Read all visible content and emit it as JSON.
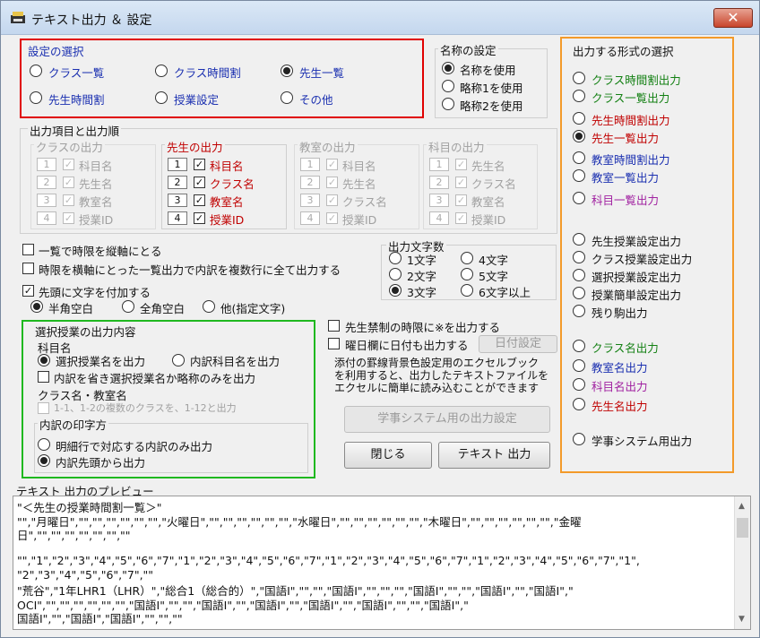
{
  "window": {
    "title": "テキスト出力 ＆ 設定",
    "close": "✕"
  },
  "setting_select": {
    "legend": "設定の選択",
    "options": [
      "クラス一覧",
      "クラス時間割",
      "先生一覧",
      "先生時間割",
      "授業設定",
      "その他"
    ],
    "selected": "先生一覧"
  },
  "name_setting": {
    "legend": "名称の設定",
    "options": [
      "名称を使用",
      "略称1を使用",
      "略称2を使用"
    ],
    "selected": "名称を使用"
  },
  "output_items": {
    "legend": "出力項目と出力順",
    "groups": [
      {
        "title": "クラスの出力",
        "items": [
          "科目名",
          "先生名",
          "教室名",
          "授業ID"
        ],
        "nums": [
          "1",
          "2",
          "3",
          "4"
        ],
        "enabled": false
      },
      {
        "title": "先生の出力",
        "items": [
          "科目名",
          "クラス名",
          "教室名",
          "授業ID"
        ],
        "nums": [
          "1",
          "2",
          "3",
          "4"
        ],
        "enabled": true
      },
      {
        "title": "教室の出力",
        "items": [
          "科目名",
          "先生名",
          "クラス名",
          "授業ID"
        ],
        "nums": [
          "1",
          "2",
          "3",
          "4"
        ],
        "enabled": false
      },
      {
        "title": "科目の出力",
        "items": [
          "先生名",
          "クラス名",
          "教室名",
          "授業ID"
        ],
        "nums": [
          "1",
          "2",
          "3",
          "4"
        ],
        "enabled": false
      }
    ]
  },
  "options": {
    "vertical_period": "一覧で時限を縦軸にとる",
    "multiline": "時限を横軸にとった一覧出力で内訳を複数行に全て出力する",
    "prefix": "先頭に文字を付加する",
    "prefix_options": [
      "半角空白",
      "全角空白",
      "他(指定文字)"
    ],
    "prefix_selected": "半角空白"
  },
  "char_count": {
    "legend": "出力文字数",
    "options": [
      "1文字",
      "4文字",
      "2文字",
      "5文字",
      "3文字",
      "6文字以上"
    ],
    "selected": "3文字"
  },
  "selected_lesson": {
    "legend": "選択授業の出力内容",
    "subject_label": "科目名",
    "subject_options": [
      "選択授業名を出力",
      "内訳科目名を出力"
    ],
    "subject_selected": "選択授業名を出力",
    "omit_label": "内訳を省き選択授業名か略称のみを出力",
    "class_room_label": "クラス名・教室名",
    "class_room_note": "1-1、1-2の複数のクラスを、1-12と出力",
    "print_label": "内訳の印字方",
    "print_options": [
      "明細行で対応する内訳のみ出力",
      "内訳先頭から出力"
    ],
    "print_selected": "内訳先頭から出力"
  },
  "middle": {
    "forbidden": "先生禁制の時限に※を出力する",
    "date_in_weekday": "曜日欄に日付も出力する",
    "date_setting_button": "日付設定",
    "note_lines": [
      "添付の罫線背景色設定用のエクセルブック",
      "を利用すると、出力したテキストファイルを",
      "エクセルに簡単に読み込むことができます"
    ],
    "gakuji_button": "学事システム用の出力設定",
    "close_button": "閉じる",
    "text_output_button": "テキスト 出力"
  },
  "format_select": {
    "legend": "出力する形式の選択",
    "items": [
      {
        "label": "クラス時間割出力",
        "color": "#138013"
      },
      {
        "label": "クラス一覧出力",
        "color": "#138013"
      },
      {
        "label": "先生時間割出力",
        "color": "#c00000"
      },
      {
        "label": "先生一覧出力",
        "color": "#c00000"
      },
      {
        "label": "教室時間割出力",
        "color": "#1a2fb0"
      },
      {
        "label": "教室一覧出力",
        "color": "#1a2fb0"
      },
      {
        "label": "科目一覧出力",
        "color": "#a020a0"
      },
      {
        "label": "先生授業設定出力",
        "color": "#111111"
      },
      {
        "label": "クラス授業設定出力",
        "color": "#111111"
      },
      {
        "label": "選択授業設定出力",
        "color": "#111111"
      },
      {
        "label": "授業簡単設定出力",
        "color": "#111111"
      },
      {
        "label": "残り駒出力",
        "color": "#111111"
      },
      {
        "label": "クラス名出力",
        "color": "#138013"
      },
      {
        "label": "教室名出力",
        "color": "#1a2fb0"
      },
      {
        "label": "科目名出力",
        "color": "#a020a0"
      },
      {
        "label": "先生名出力",
        "color": "#c00000"
      },
      {
        "label": "学事システム用出力",
        "color": "#111111"
      }
    ],
    "selected": "先生一覧出力"
  },
  "preview": {
    "label": "テキスト 出力のプレビュー",
    "lines": [
      "\"＜先生の授業時間割一覧＞\"",
      "\"\",\"月曜日\",\"\",\"\",\"\",\"\",\"\",\"\",\"火曜日\",\"\",\"\",\"\",\"\",\"\",\"\",\"水曜日\",\"\",\"\",\"\",\"\",\"\",\"\",\"木曜日\",\"\",\"\",\"\",\"\",\"\",\"\",\"金曜",
      "日\",\"\",\"\",\"\",\"\",\"\",\"\",\"\"",
      "",
      "\"\",\"1\",\"2\",\"3\",\"4\",\"5\",\"6\",\"7\",\"1\",\"2\",\"3\",\"4\",\"5\",\"6\",\"7\",\"1\",\"2\",\"3\",\"4\",\"5\",\"6\",\"7\",\"1\",\"2\",\"3\",\"4\",\"5\",\"6\",\"7\",\"1\",",
      "\"2\",\"3\",\"4\",\"5\",\"6\",\"7\",\"\"",
      "\"荒谷\",\"1年LHR1（LHR）\",\"総合1（総合的）\",\"国語Ⅰ\",\"\",\"\",\"国語Ⅰ\",\"\",\"\",\"\",\"国語Ⅰ\",\"\",\"\",\"国語Ⅰ\",\"\",\"国語Ⅰ\",\"",
      "OCⅠ\",\"\",\"\",\"\",\"\",\"\",\"\",\"国語Ⅰ\",\"\",\"\",\"国語Ⅰ\",\"\",\"国語Ⅰ\",\"\",\"国語Ⅰ\",\"\",\"国語Ⅰ\",\"\",\"\",\"国語Ⅰ\",\"",
      "国語Ⅰ\",\"\",\"国語Ⅰ\",\"国語Ⅰ\",\"\",\"\",\"\""
    ]
  }
}
